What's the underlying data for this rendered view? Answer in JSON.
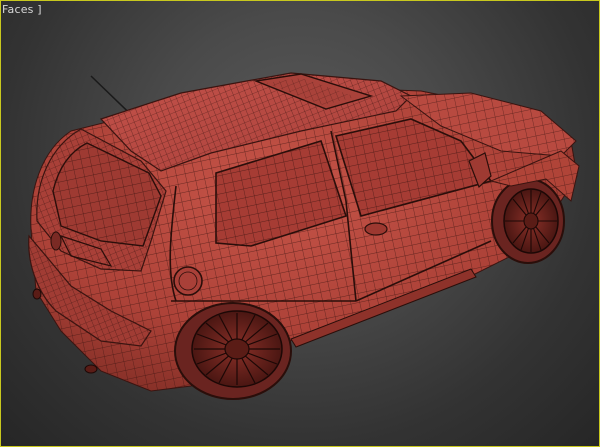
{
  "viewport": {
    "label": "Faces ]",
    "frame_color": "#c8c81e",
    "background": "#3c3c3c"
  },
  "model": {
    "body_color": "#b4463c",
    "wire_color": "#3a1410",
    "window_color": "#a63c34",
    "shading": "edged-faces"
  }
}
